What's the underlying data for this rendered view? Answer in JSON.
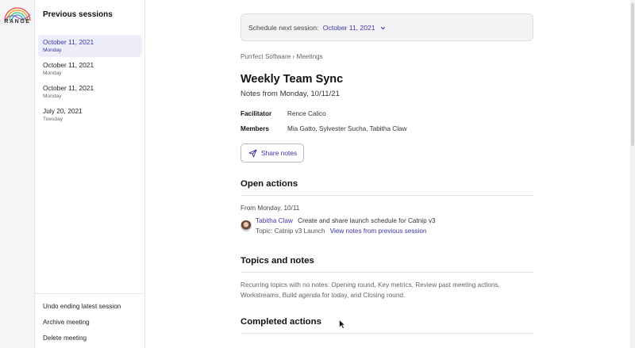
{
  "brand": {
    "name": "RANGE"
  },
  "sidebar": {
    "title": "Previous sessions",
    "sessions": [
      {
        "date": "October 11, 2021",
        "weekday": "Monday",
        "active": true
      },
      {
        "date": "October 11, 2021",
        "weekday": "Monday",
        "active": false
      },
      {
        "date": "October 11, 2021",
        "weekday": "Monday",
        "active": false
      },
      {
        "date": "July 20, 2021",
        "weekday": "Tuesday",
        "active": false
      }
    ],
    "actions": [
      "Undo ending latest session",
      "Archive meeting",
      "Delete meeting"
    ]
  },
  "schedule": {
    "label": "Schedule next session:",
    "date": "October 11, 2021",
    "icon": "chevron-down-icon"
  },
  "breadcrumb": {
    "org": "Purrfect Software",
    "separator": "›",
    "section": "Meetings"
  },
  "meeting": {
    "title": "Weekly Team Sync",
    "subtitle": "Notes from Monday, 10/11/21",
    "facilitator_label": "Facilitator",
    "facilitator": "Rence Calico",
    "members_label": "Members",
    "members": "Mia Gatto, Sylvester Sucha, Tabitha Claw",
    "share_label": "Share notes",
    "share_icon": "send-icon"
  },
  "open_actions": {
    "title": "Open actions",
    "from": "From Monday, 10/11",
    "item": {
      "assignee": "Tabitha Claw",
      "text": "Create and share launch schedule for Catnip v3",
      "topic": "Topic: Catnip v3 Launch",
      "link": "View notes from previous session"
    }
  },
  "topics": {
    "title": "Topics and notes",
    "recurring": "Recurring topics with no notes: Opening round, Key metrics, Review past meeting actions, Workstreams, Build agenda for today, and Closing round."
  },
  "completed": {
    "title": "Completed actions"
  },
  "colors": {
    "accent": "#3b35a8",
    "active_bg": "#eeeefb"
  }
}
